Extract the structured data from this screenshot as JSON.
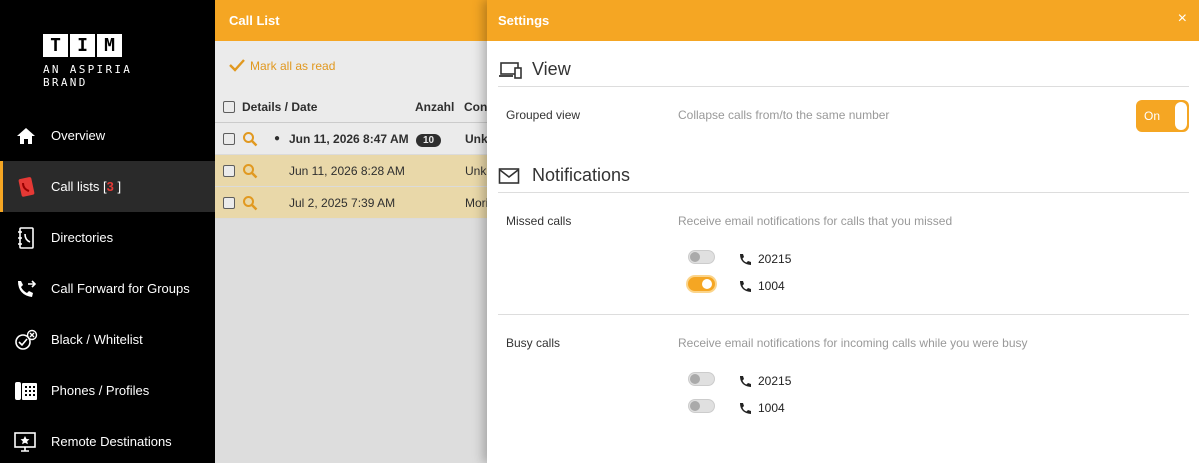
{
  "logo": {
    "letters": [
      "T",
      "I",
      "M"
    ],
    "subtitle": "AN ASPIRIA BRAND"
  },
  "nav": [
    {
      "label": "Overview",
      "icon": "home-icon"
    },
    {
      "label": "Call lists [",
      "count": "3",
      "suffix": "]",
      "icon": "call-list-icon",
      "active": true
    },
    {
      "label": "Directories",
      "icon": "directory-icon"
    },
    {
      "label": "Call Forward for Groups",
      "icon": "call-forward-icon"
    },
    {
      "label": "Black / Whitelist",
      "icon": "blacklist-icon"
    },
    {
      "label": "Phones / Profiles",
      "icon": "phone-profile-icon"
    },
    {
      "label": "Remote Destinations",
      "icon": "remote-destination-icon"
    }
  ],
  "calllist": {
    "title": "Call List",
    "mark_all": "Mark all as read",
    "columns": {
      "details": "Details / Date",
      "count": "Anzahl",
      "contact": "Cont"
    },
    "rows": [
      {
        "date": "Jun 11, 2026 8:47 AM",
        "count": "10",
        "contact": "Unkn",
        "unread": true
      },
      {
        "date": "Jun 11, 2026 8:28 AM",
        "count": "",
        "contact": "Unkn",
        "unread": false
      },
      {
        "date": "Jul 2, 2025 7:39 AM",
        "count": "",
        "contact": "Mori",
        "unread": false
      }
    ]
  },
  "settings": {
    "title": "Settings",
    "close": "×",
    "view": {
      "title": "View",
      "grouped_label": "Grouped view",
      "grouped_desc": "Collapse calls from/to the same number",
      "grouped_toggle": "On"
    },
    "notifications": {
      "title": "Notifications",
      "missed": {
        "label": "Missed calls",
        "desc": "Receive email notifications for calls that you missed",
        "lines": [
          {
            "number": "20215",
            "enabled": false
          },
          {
            "number": "1004",
            "enabled": true
          }
        ]
      },
      "busy": {
        "label": "Busy calls",
        "desc": "Receive email notifications for incoming calls while you were busy",
        "lines": [
          {
            "number": "20215",
            "enabled": false
          },
          {
            "number": "1004",
            "enabled": false
          }
        ]
      }
    }
  },
  "colors": {
    "accent": "#f5a623",
    "highlight": "#fdebb8",
    "badge": "#e53935"
  }
}
